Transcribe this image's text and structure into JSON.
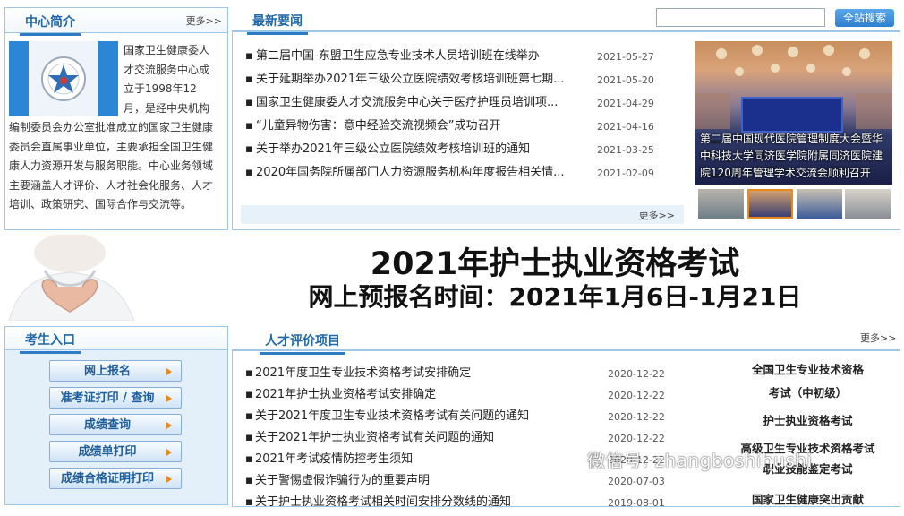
{
  "intro": {
    "title": "中心简介",
    "more": "更多>>",
    "text": "国家卫生健康委人才交流服务中心成立于1998年12月，是经中央机构编制委员会办公室批准成立的国家卫生健康委员会直属事业单位，主要承担全国卫生健康人力资源开发与服务职能。中心业务领域主要涵盖人才评价、人才社会化服务、人才培训、政策研究、国际合作与交流等。"
  },
  "news": {
    "title": "最新要闻",
    "more": "更多>>",
    "items": [
      {
        "title": "第二届中国-东盟卫生应急专业技术人员培训班在线举办",
        "date": "2021-05-27"
      },
      {
        "title": "关于延期举办2021年三级公立医院绩效考核培训班第七期...",
        "date": "2021-05-20"
      },
      {
        "title": "国家卫生健康委人才交流服务中心关于医疗护理员培训项...",
        "date": "2021-04-29"
      },
      {
        "title": "“儿童异物伤害：意中经验交流视频会”成功召开",
        "date": "2021-04-16"
      },
      {
        "title": "关于举办2021年三级公立医院绩效考核培训班的通知",
        "date": "2021-03-25"
      },
      {
        "title": "2020年国务院所属部门人力资源服务机构年度报告相关情...",
        "date": "2021-02-09"
      }
    ]
  },
  "search": {
    "placeholder": "",
    "button": "全站搜索"
  },
  "photo": {
    "caption": "第二届中国现代医院管理制度大会暨华中科技大学同济医学院附属同济医院建院120周年管理学术交流会顺利召开"
  },
  "banner": {
    "line1": "2021年护士执业资格考试",
    "line2": "网上预报名时间：2021年1月6日-1月21日"
  },
  "entrance": {
    "title": "考生入口",
    "buttons": [
      "网上报名",
      "准考证打印 / 查询",
      "成绩查询",
      "成绩单打印",
      "成绩合格证明打印"
    ]
  },
  "talent": {
    "title": "人才评价项目",
    "more": "更多>>",
    "items": [
      {
        "title": "2021年度卫生专业技术资格考试安排确定",
        "date": "2020-12-22"
      },
      {
        "title": "2021年护士执业资格考试安排确定",
        "date": "2020-12-22"
      },
      {
        "title": "关于2021年度卫生专业技术资格考试有关问题的通知",
        "date": "2020-12-22"
      },
      {
        "title": "关于2021年护士执业资格考试有关问题的通知",
        "date": "2020-12-22"
      },
      {
        "title": "2021年考试疫情防控考生须知",
        "date": "2020-12-22"
      },
      {
        "title": "关于警惕虚假诈骗行为的重要声明",
        "date": "2020-07-03"
      },
      {
        "title": "关于护士执业资格考试相关时间安排分数线的通知",
        "date": "2019-08-01"
      }
    ],
    "side_links": [
      "全国卫生专业技术资格",
      "考试（中初级）",
      "护士执业资格考试",
      "高级卫生专业技术资格考试",
      "职业技能鉴定考试",
      "国家卫生健康突出贡献"
    ]
  },
  "watermark": "微信号: zhangboshihushi",
  "colors": {
    "accent": "#1f67a8",
    "border": "#9ec7e6",
    "button": "#2c7fd1"
  }
}
